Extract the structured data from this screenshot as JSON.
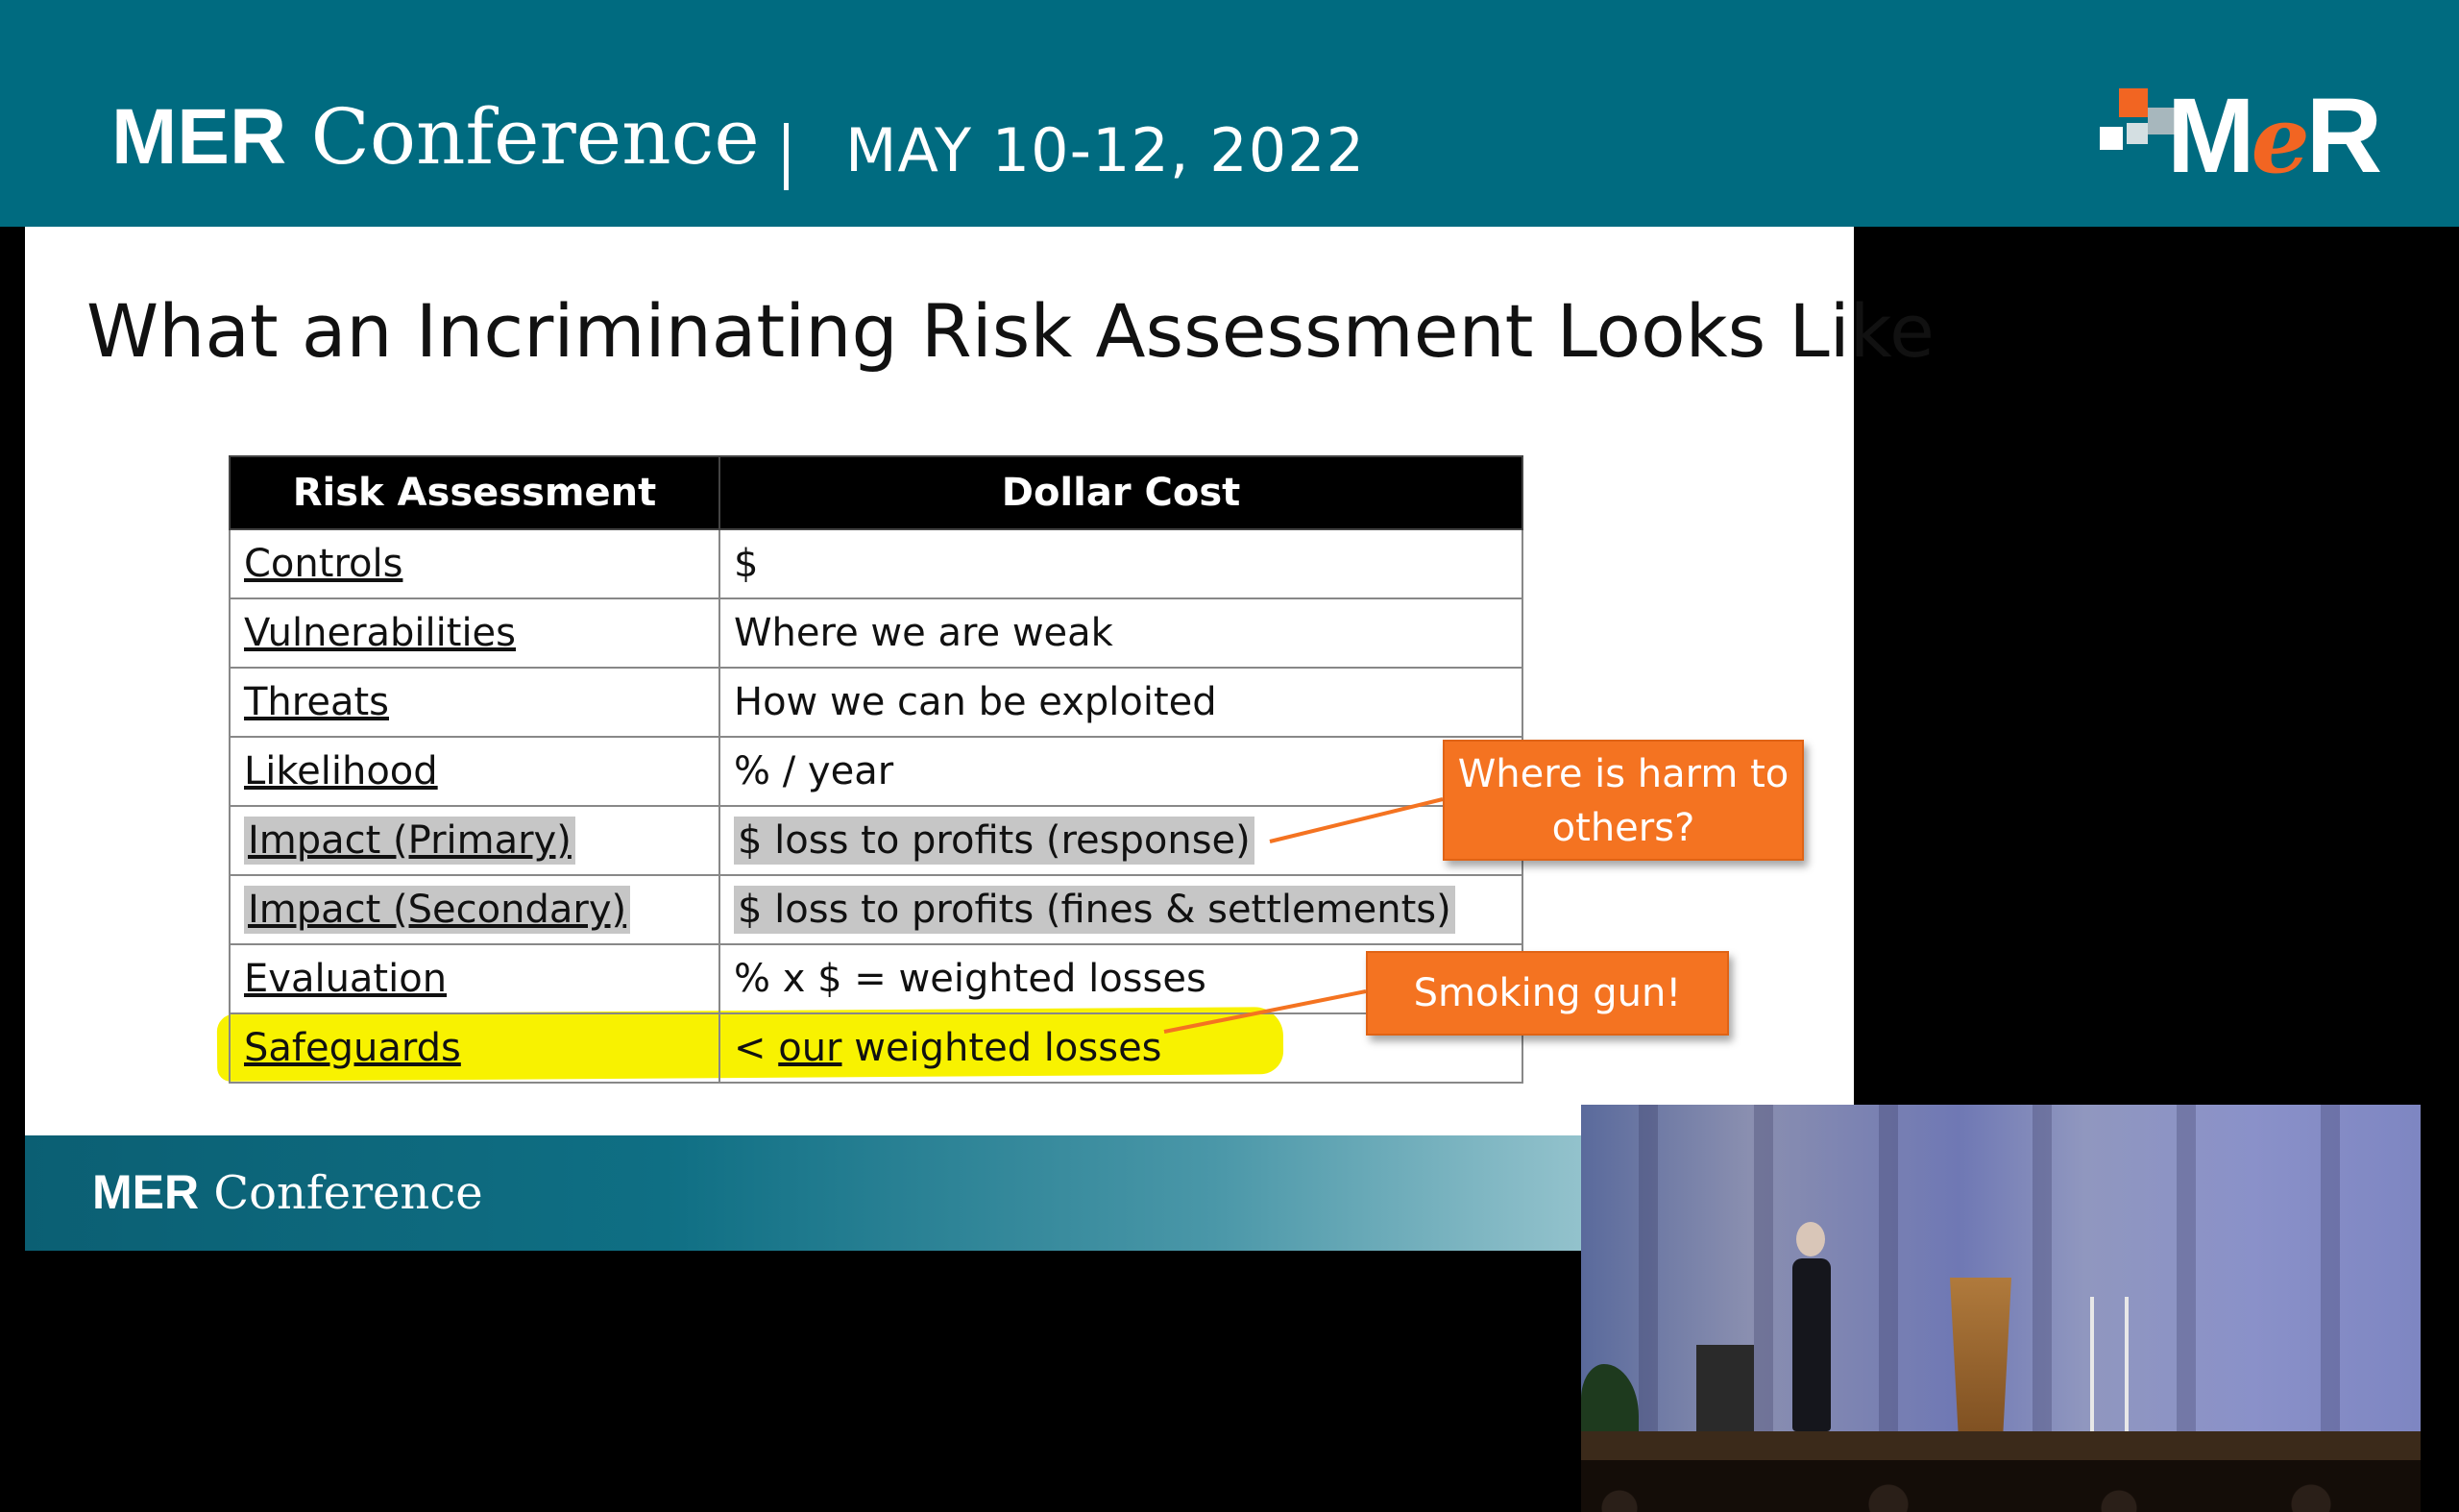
{
  "banner": {
    "conference_bold": "MER",
    "conference_rest": " Conference",
    "date": "MAY 10-12, 2022",
    "logo_text_m": "M",
    "logo_text_e": "e",
    "logo_text_r": "R"
  },
  "slide": {
    "title": "What an Incriminating Risk Assessment Looks Like",
    "table": {
      "headers": [
        "Risk Assessment",
        "Dollar Cost"
      ],
      "rows": [
        {
          "term": "Controls",
          "value": "$"
        },
        {
          "term": "Vulnerabilities",
          "value": "Where we are weak"
        },
        {
          "term": "Threats",
          "value": "How we can be exploited"
        },
        {
          "term": "Likelihood",
          "value": "% / year"
        },
        {
          "term": "Impact (Primary)",
          "value": "$ loss to profits (response)"
        },
        {
          "term": "Impact (Secondary)",
          "value": "$ loss to profits (fines & settlements)"
        },
        {
          "term": "Evaluation",
          "value": "% x $ = weighted losses"
        },
        {
          "term": "Safeguards",
          "value_prefix": "< ",
          "value_underlined": "our",
          "value_suffix": " weighted losses"
        }
      ]
    },
    "callouts": {
      "harm": "Where is harm to others?",
      "gun": "Smoking gun!"
    },
    "footer": {
      "bold": "MER",
      "rest": " Conference"
    }
  },
  "colors": {
    "banner": "#006b80",
    "callout": "#f47321",
    "highlight_yellow": "#f8f200",
    "highlight_gray": "#c6c6c6",
    "logo_accent": "#f26522"
  }
}
